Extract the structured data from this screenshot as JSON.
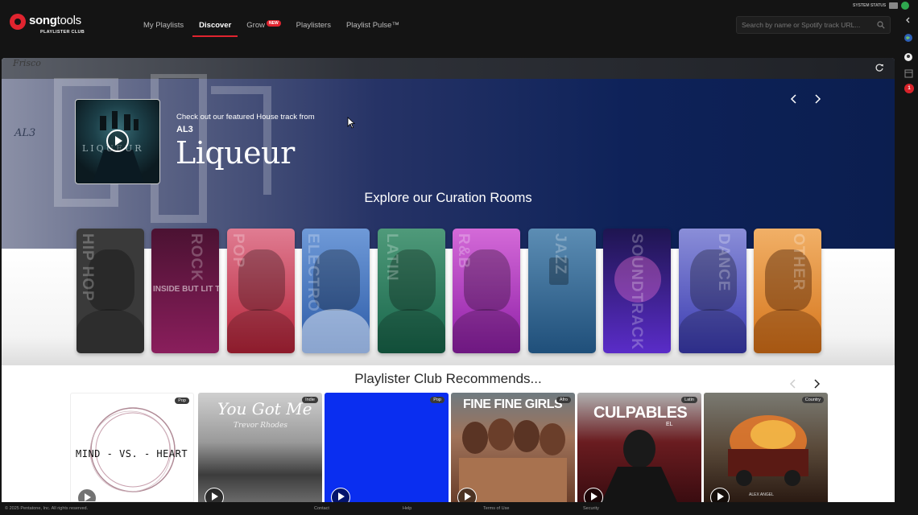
{
  "brand": {
    "word_bold": "song",
    "word_light": "tools",
    "sub": "PLAYLISTER CLUB"
  },
  "nav": {
    "items": [
      {
        "label": "My Playlists",
        "active": false
      },
      {
        "label": "Discover",
        "active": true
      },
      {
        "label": "Grow",
        "active": false,
        "badge": "NEW"
      },
      {
        "label": "Playlisters",
        "active": false
      },
      {
        "label": "Playlist Pulse™",
        "active": false
      }
    ]
  },
  "search": {
    "placeholder": "Search by name or Spotify track URL..."
  },
  "system_status": {
    "label": "SYSTEM STATUS"
  },
  "rail": {
    "notification_count": "1"
  },
  "hero": {
    "watermark": "Frisco",
    "wall_tag": "AL3",
    "album_text": "LIQUEUR",
    "kicker": "Check out our featured House track from",
    "artist": "AL3",
    "track": "Liqueur",
    "rooms_title": "Explore our Curation Rooms"
  },
  "rooms": [
    {
      "label": "HIP HOP",
      "sub": "",
      "color": "#3a3a3a"
    },
    {
      "label": "ROCK",
      "sub": "INSIDE BUT LIT TO",
      "color": "#6b1846"
    },
    {
      "label": "POP",
      "sub": "",
      "color": "#c13a52"
    },
    {
      "label": "ELECTRO",
      "sub": "",
      "color": "#2e5c9c"
    },
    {
      "label": "LATIN",
      "sub": "",
      "color": "#1f7a5a"
    },
    {
      "label": "R&B",
      "sub": "",
      "color": "#a52fb8"
    },
    {
      "label": "JAZZ",
      "sub": "",
      "color": "#2a5f86"
    },
    {
      "label": "SOUNDTRACK",
      "sub": "",
      "color": "#4a2aa0"
    },
    {
      "label": "DANCE",
      "sub": "",
      "color": "#3f42b0"
    },
    {
      "label": "OTHER",
      "sub": "",
      "color": "#d9861e"
    }
  ],
  "recommends": {
    "title": "Playlister Club Recommends...",
    "cards": [
      {
        "genre": "Pop",
        "art_text": "MIND - VS. - HEART",
        "bg": "#ffffff"
      },
      {
        "genre": "Indie",
        "art_text": "You Got Me",
        "art_sub": "Trevor Rhodes",
        "bg": "#5f5f5f"
      },
      {
        "genre": "Pop",
        "art_text": "",
        "bg": "#0a2ef0"
      },
      {
        "genre": "Afro",
        "art_text": "FINE FINE GIRLS",
        "bg": "#8a5a3e"
      },
      {
        "genre": "Latin",
        "art_text": "CULPABLES",
        "art_sub": "EL",
        "bg": "#6a1c20"
      },
      {
        "genre": "Country",
        "art_text": "ALEX ANGEL",
        "bg": "#4a2a1c"
      }
    ]
  },
  "footer": {
    "copyright": "© 2025 Pentatone, Inc. All rights reserved.",
    "contact": "Contact",
    "help": "Help",
    "terms": "Terms of Use",
    "security": "Security"
  }
}
